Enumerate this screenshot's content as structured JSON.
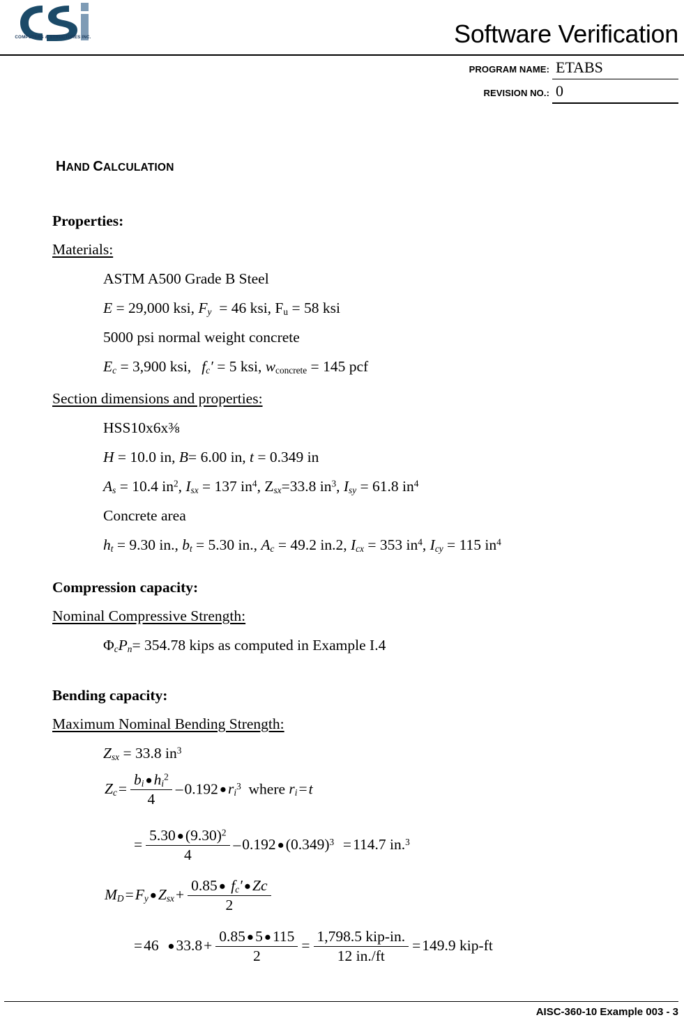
{
  "header": {
    "doc_title": "Software Verification",
    "logo_caption": "COMPUTERS & STRUCTURES INC.",
    "logo_letters": "CSi",
    "program_name_label": "PROGRAM NAME:",
    "program_name_value": "ETABS",
    "revision_label": "REVISION NO.:",
    "revision_value": "0"
  },
  "footer": {
    "reference": "AISC-360-10 Example 003 - 3"
  },
  "body": {
    "section_heading": {
      "first_caps": "H",
      "rest_caps": "AND ",
      "second_caps": "C",
      "rest2_caps": "ALCULATION",
      "plain": "HAND CALCULATION"
    },
    "properties_heading": "Properties:",
    "materials_heading": "Materials:",
    "material_lines": [
      {
        "id": "steel-grade",
        "text": "ASTM A500 Grade B Steel"
      },
      {
        "id": "steel-moduli",
        "text": "E = 29,000 ksi, Fy  = 46 ksi, Fu = 58 ksi"
      },
      {
        "id": "concrete-strength",
        "text": "5000 psi normal weight concrete"
      },
      {
        "id": "concrete-moduli",
        "text": "Ec = 3,900 ksi,  f'c = 5 ksi, wconcrete = 145 pcf"
      }
    ],
    "section_dims_heading": "Section dimensions and properties:",
    "section_lines": [
      {
        "id": "hss-label",
        "text": "HSS10x6x⅜"
      },
      {
        "id": "hss-dims",
        "text": "H = 10.0 in, B= 6.00 in, t = 0.349 in"
      },
      {
        "id": "hss-props",
        "text": "As = 10.4 in2, Isx = 137 in4, Zsx=33.8 in3, Isy = 61.8 in4"
      },
      {
        "id": "concrete-area-label",
        "text": "Concrete area"
      },
      {
        "id": "concrete-props",
        "text": "ht = 9.30 in., bt = 5.30 in., Ac = 49.2 in.2, Icx = 353 in4, Icy = 115 in4"
      }
    ],
    "compression_heading": "Compression capacity:",
    "nominal_compressive_heading": "Nominal Compressive Strength:",
    "compression_line": "ΦcPn= 354.78 kips as computed in Example I.4",
    "bending_heading": "Bending capacity:",
    "max_nominal_bending_heading": "Maximum Nominal Bending Strength:",
    "zsx_line": "Zsx = 33.8 in3"
  },
  "values": {
    "E": "29,000",
    "Fy": "46",
    "Fu": "58",
    "concrete_psi": "5000",
    "Ec": "3,900",
    "fc_prime": "5",
    "w_concrete": "145",
    "H": "10.0",
    "B": "6.00",
    "t": "0.349",
    "As": "10.4",
    "Isx": "137",
    "Zsx": "33.8",
    "Isy": "61.8",
    "ht": "9.30",
    "bt": "5.30",
    "Ac": "49.2",
    "Icx": "353",
    "Icy": "115",
    "phiPn": "354.78",
    "example_ref": "I.4",
    "coef_0192": "0.192",
    "Zc_result": "114.7",
    "coef_085": "0.85",
    "numer_total": "1,798.5",
    "denom_conv": "12 in./ft",
    "MD_result": "149.9",
    "units": {
      "ksi": "ksi",
      "pcf": "pcf",
      "in": "in",
      "kips": "kips",
      "kip_in": "kip-in.",
      "kip_ft": "kip-ft",
      "in3": "in.",
      "hss_section": "HSS10x6x⅜"
    }
  },
  "equations": {
    "zc_def": {
      "lhs": "Zc",
      "num_b": "bi",
      "num_h": "hi",
      "num_exp": "2",
      "den": "4",
      "minus_coef": "0.192",
      "r_sym": "ri",
      "r_exp": "3",
      "where": "where",
      "r_def_lhs": "ri",
      "r_def_rhs": "t"
    },
    "zc_eval": {
      "num_a": "5.30",
      "num_b": "(9.30)",
      "num_b_exp": "2",
      "den": "4",
      "minus_coef": "0.192",
      "paren": "(0.349)",
      "paren_exp": "3",
      "result": "114.7",
      "result_unit": "in.",
      "result_unit_exp": "3"
    },
    "md_def": {
      "lhs": "MD",
      "Fy": "Fy",
      "Zsx": "Zsx",
      "coef": "0.85",
      "fc": "f'c",
      "Zc": "Zc",
      "den": "2"
    },
    "md_eval": {
      "Fy_val": "46",
      "Zsx_val": "33.8",
      "coef": "0.85",
      "fc_val": "5",
      "Zc_val": "115",
      "den1": "2",
      "num2": "1,798.5 kip-in.",
      "den2": "12 in./ft",
      "result": "149.9 kip-ft"
    }
  },
  "colors": {
    "logo_dark": "#1b4a68",
    "logo_light": "#7e9bb5",
    "text": "#000000",
    "rule": "#000000"
  }
}
